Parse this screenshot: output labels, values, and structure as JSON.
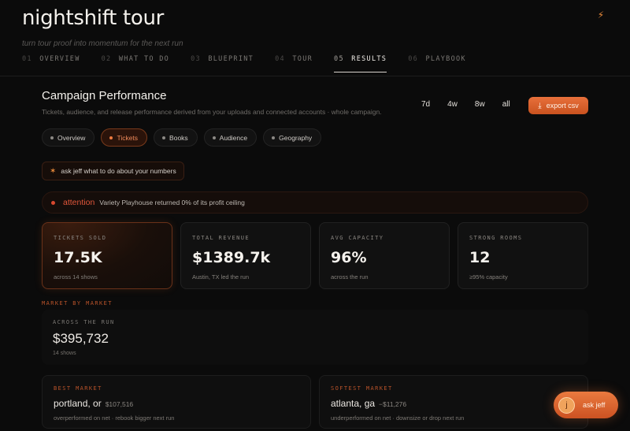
{
  "app": {
    "title": "nightshift tour",
    "tagline": "turn tour proof into momentum for the next run",
    "bolt_icon": "⚡"
  },
  "tabs": [
    {
      "num": "01",
      "label": "OVERVIEW"
    },
    {
      "num": "02",
      "label": "WHAT TO DO"
    },
    {
      "num": "03",
      "label": "BLUEPRINT"
    },
    {
      "num": "04",
      "label": "TOUR"
    },
    {
      "num": "05",
      "label": "RESULTS",
      "active": true
    },
    {
      "num": "06",
      "label": "PLAYBOOK"
    }
  ],
  "section": {
    "title": "Campaign Performance",
    "subtitle": "Tickets, audience, and release performance derived from your uploads and connected accounts · whole campaign."
  },
  "ranges": [
    "7d",
    "4w",
    "8w",
    "all"
  ],
  "export_label": "export csv",
  "subtabs": [
    "Overview",
    "Tickets",
    "Books",
    "Audience",
    "Geography"
  ],
  "ask_inline": "ask jeff what to do about your numbers",
  "alert": {
    "label": "attention",
    "text": "Variety Playhouse returned 0% of its profit ceiling"
  },
  "kpis": [
    {
      "label": "TICKETS SOLD",
      "value": "17.5K",
      "note": "across 14 shows"
    },
    {
      "label": "TOTAL REVENUE",
      "value": "$1389.7k",
      "note": "Austin, TX led the run"
    },
    {
      "label": "AVG CAPACITY",
      "value": "96%",
      "note": "across the run"
    },
    {
      "label": "STRONG ROOMS",
      "value": "12",
      "note": "≥95% capacity"
    }
  ],
  "market": {
    "section_label": "MARKET BY MARKET",
    "run_label": "ACROSS THE RUN",
    "run_value": "$395,732",
    "run_note": "14 shows",
    "best": {
      "label": "BEST MARKET",
      "city": "portland, or",
      "amount": "$107,516",
      "note": "overperformed on net · rebook bigger next run"
    },
    "softest": {
      "label": "SOFTEST MARKET",
      "city": "atlanta, ga",
      "amount": "−$11,276",
      "note": "underperformed on net · downsize or drop next run"
    }
  },
  "fab": {
    "avatar_letter": "j",
    "label": "ask jeff"
  },
  "colors": {
    "accent": "#e8703b",
    "alert": "#e0563a",
    "background": "#0b0b0b"
  }
}
